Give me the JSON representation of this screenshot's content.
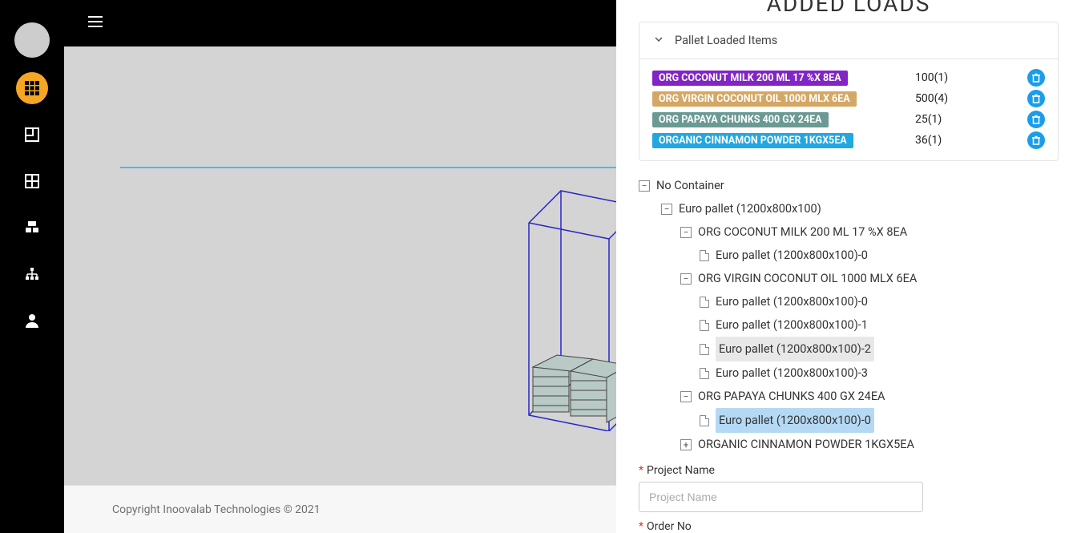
{
  "panel": {
    "title": "ADDED LOADS",
    "section_header": "Pallet Loaded Items"
  },
  "loads": [
    {
      "label": "ORG COCONUT MILK 200 ML 17 %X 8EA",
      "qty": "100(1)",
      "color": "#8224c6"
    },
    {
      "label": "ORG VIRGIN COCONUT OIL 1000 MLX 6EA",
      "qty": "500(4)",
      "color": "#d4a764"
    },
    {
      "label": "ORG PAPAYA CHUNKS 400 GX 24EA",
      "qty": "25(1)",
      "color": "#6a9a93"
    },
    {
      "label": "ORGANIC CINNAMON POWDER 1KGX5EA",
      "qty": "36(1)",
      "color": "#23a7e0"
    }
  ],
  "tree": {
    "root": "No Container",
    "n1": "Euro pallet (1200x800x100)",
    "g0": "ORG COCONUT MILK 200 ML 17 %X 8EA",
    "g0_0": "Euro pallet (1200x800x100)-0",
    "g1": "ORG VIRGIN COCONUT OIL 1000 MLX 6EA",
    "g1_0": "Euro pallet (1200x800x100)-0",
    "g1_1": "Euro pallet (1200x800x100)-1",
    "g1_2": "Euro pallet (1200x800x100)-2",
    "g1_3": "Euro pallet (1200x800x100)-3",
    "g2": "ORG PAPAYA CHUNKS 400 GX 24EA",
    "g2_0": "Euro pallet (1200x800x100)-0",
    "g3": "ORGANIC CINNAMON POWDER 1KGX5EA"
  },
  "form": {
    "project_label": "Project Name",
    "project_placeholder": "Project Name",
    "order_label": "Order No"
  },
  "footer": {
    "text": "Copyright Inoovalab Technologies © 2021"
  }
}
